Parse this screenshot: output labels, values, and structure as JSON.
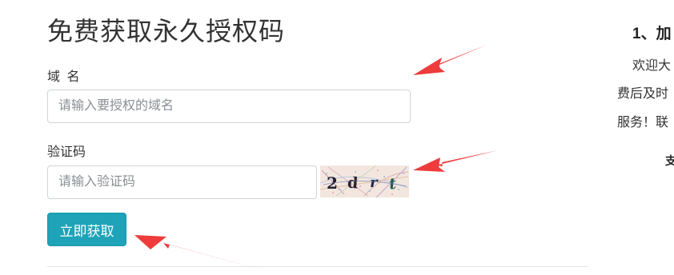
{
  "form": {
    "title": "免费获取永久授权码",
    "domain_label": "域 名",
    "domain_placeholder": "请输入要授权的域名",
    "domain_value": "",
    "captcha_label": "验证码",
    "captcha_placeholder": "请输入验证码",
    "captcha_value": "",
    "captcha_image_text": "2drt",
    "submit_label": "立即获取"
  },
  "side_panel": {
    "heading": "1、加",
    "lines": [
      "欢迎大",
      "费后及时",
      "服务！联",
      "支"
    ]
  },
  "colors": {
    "accent": "#1ea3b8",
    "annotation_arrow": "#ee3b3b",
    "captcha_background": "#f3e6df"
  },
  "icons": {
    "annotation": "red-arrow-icon"
  }
}
